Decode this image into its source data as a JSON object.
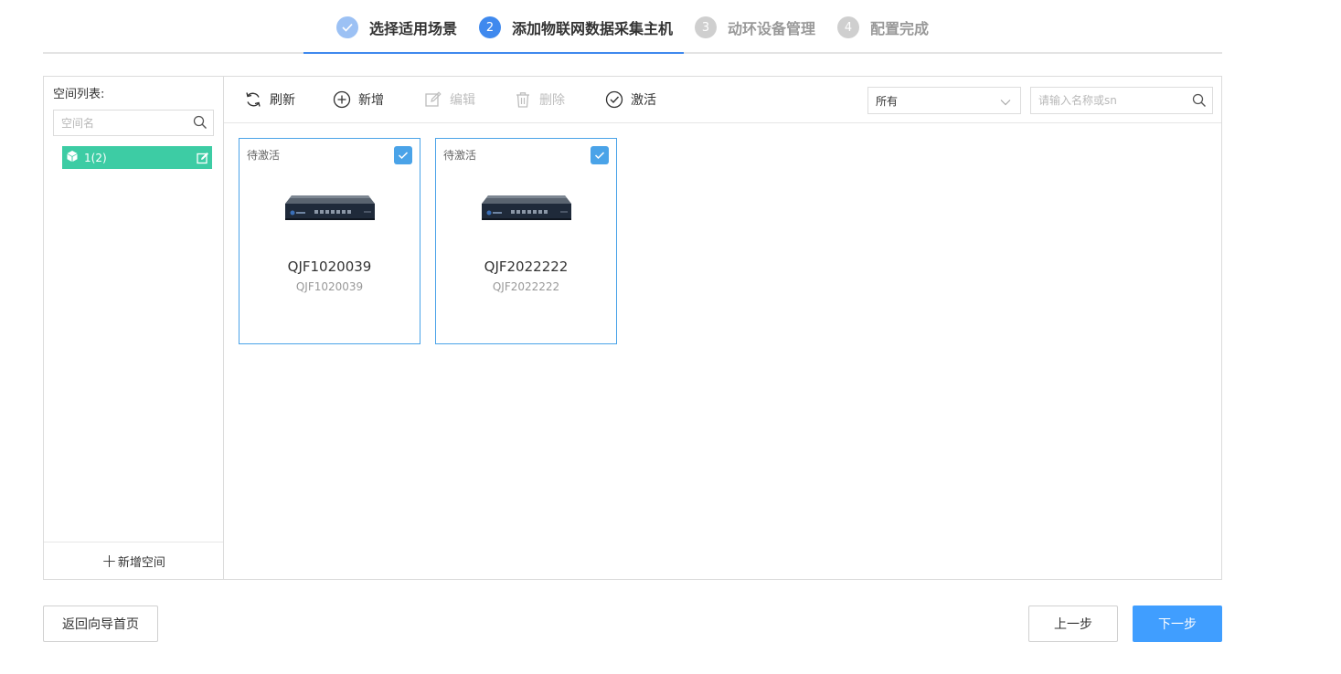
{
  "stepper": {
    "steps": [
      {
        "number": "",
        "label": "选择适用场景",
        "state": "done"
      },
      {
        "number": "2",
        "label": "添加物联网数据采集主机",
        "state": "active"
      },
      {
        "number": "3",
        "label": "动环设备管理",
        "state": "todo"
      },
      {
        "number": "4",
        "label": "配置完成",
        "state": "todo"
      }
    ]
  },
  "sidebar": {
    "title": "空间列表:",
    "search_placeholder": "空间名",
    "spaces": [
      {
        "label": "1(2)",
        "selected": true
      }
    ],
    "add_space_plus": "+",
    "add_space_label": "新增空间"
  },
  "toolbar": {
    "refresh": "刷新",
    "add": "新增",
    "edit": "编辑",
    "delete": "删除",
    "activate": "激活",
    "filter_value": "所有",
    "search_placeholder": "请输入名称或sn"
  },
  "devices": [
    {
      "status": "待激活",
      "name": "QJF1020039",
      "sn": "QJF1020039",
      "checked": true
    },
    {
      "status": "待激活",
      "name": "QJF2022222",
      "sn": "QJF2022222",
      "checked": true
    }
  ],
  "footer": {
    "back_label": "返回向导首页",
    "prev_label": "上一步",
    "next_label": "下一步"
  },
  "colors": {
    "primary": "#409eff",
    "step_active": "#3f89ee",
    "step_done": "#9cc1f4",
    "space_selected": "#3dcca4",
    "card_border": "#4aa3e8"
  }
}
